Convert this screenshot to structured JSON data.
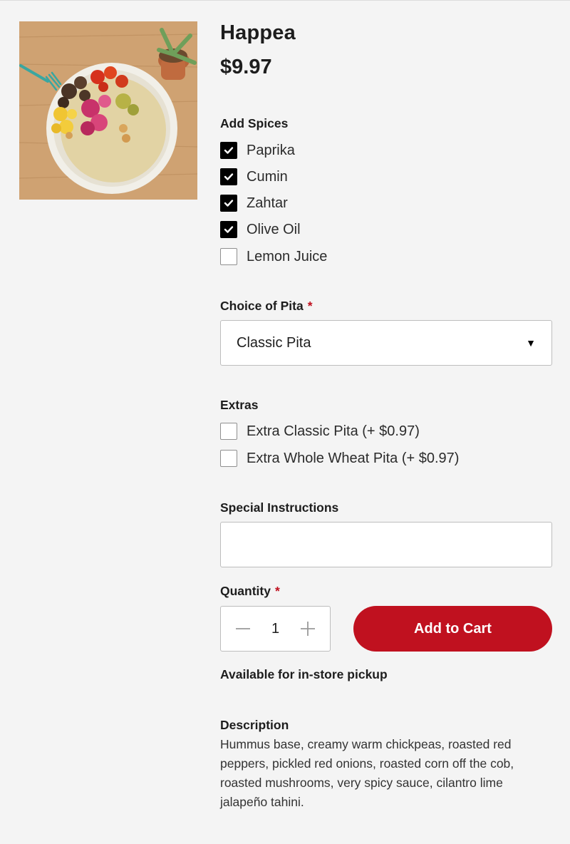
{
  "product": {
    "name": "Happea",
    "price": "$9.97"
  },
  "spices": {
    "label": "Add Spices",
    "options": [
      {
        "label": "Paprika",
        "checked": true
      },
      {
        "label": "Cumin",
        "checked": true
      },
      {
        "label": "Zahtar",
        "checked": true
      },
      {
        "label": "Olive Oil",
        "checked": true
      },
      {
        "label": "Lemon Juice",
        "checked": false
      }
    ]
  },
  "pita": {
    "label": "Choice of Pita",
    "required_mark": "*",
    "selected": "Classic Pita"
  },
  "extras": {
    "label": "Extras",
    "options": [
      {
        "label": "Extra Classic Pita (+ $0.97)",
        "checked": false
      },
      {
        "label": "Extra Whole Wheat Pita (+ $0.97)",
        "checked": false
      }
    ]
  },
  "instructions": {
    "label": "Special Instructions",
    "value": ""
  },
  "quantity": {
    "label": "Quantity",
    "required_mark": "*",
    "value": "1"
  },
  "cart": {
    "button_label": "Add to Cart"
  },
  "pickup_note": "Available for in-store pickup",
  "description": {
    "label": "Description",
    "text": "Hummus base, creamy warm chickpeas, roasted red peppers, pickled red onions, roasted corn off the cob, roasted mushrooms, very spicy sauce, cilantro lime jalapeño tahini."
  },
  "colors": {
    "accent": "#c0111f",
    "background": "#f4f4f4"
  }
}
